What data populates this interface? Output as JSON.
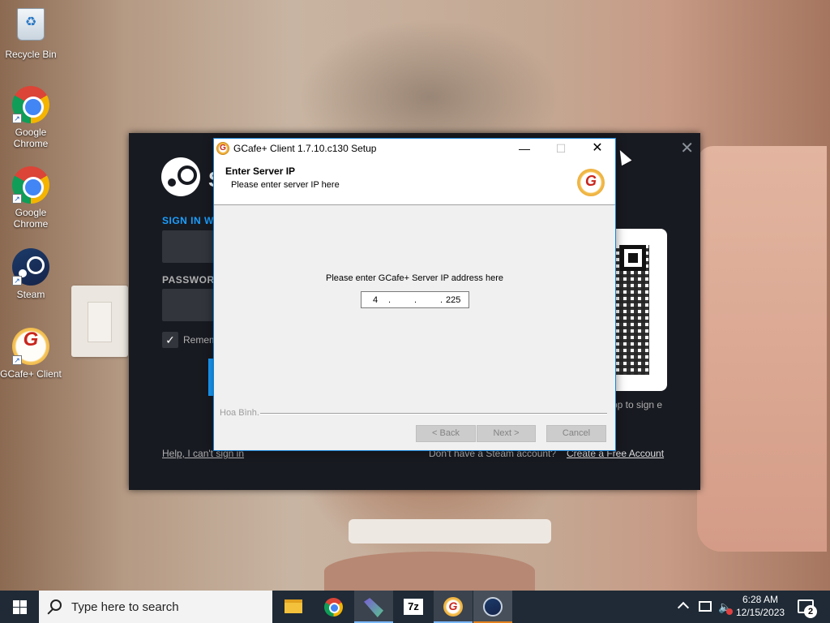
{
  "desktop": {
    "icons": [
      {
        "label": "Recycle Bin"
      },
      {
        "label": "Google Chrome"
      },
      {
        "label": "Google Chrome"
      },
      {
        "label": "Steam"
      },
      {
        "label": "GCafe+ Client"
      }
    ]
  },
  "steam_window": {
    "title_partial": "S",
    "sign_in_label_partial": "SIGN IN W",
    "password_label_partial": "PASSWORD",
    "remember_partial": "Remem",
    "app_text_partial": "pp to sign e",
    "help_link": "Help, I can't sign in",
    "no_account_text": "Don't have a Steam account?",
    "create_account_link": "Create a Free Account"
  },
  "setup_dialog": {
    "title": "GCafe+ Client 1.7.10.c130 Setup",
    "header_title": "Enter Server IP",
    "header_subtitle": "Please enter server IP here",
    "prompt": "Please enter GCafe+ Server IP address here",
    "ip_octets": [
      "4",
      "",
      "",
      "225"
    ],
    "branding": "Hoa Bình.",
    "back_label": "< Back",
    "next_label": "Next >",
    "cancel_label": "Cancel"
  },
  "taskbar": {
    "search_placeholder": "Type here to search",
    "apps": [
      "file-explorer",
      "google-chrome",
      "visual-studio",
      "7-zip",
      "gcafe-client",
      "steam"
    ],
    "active_apps": [
      "visual-studio",
      "gcafe-client",
      "steam"
    ],
    "time": "6:28 AM",
    "date": "12/15/2023",
    "notification_count": "2"
  },
  "colors": {
    "steam_blue": "#1a9fff",
    "steam_bg": "#181a21",
    "dialog_accent": "#1883d7",
    "taskbar_bg": "#1f2a36"
  }
}
